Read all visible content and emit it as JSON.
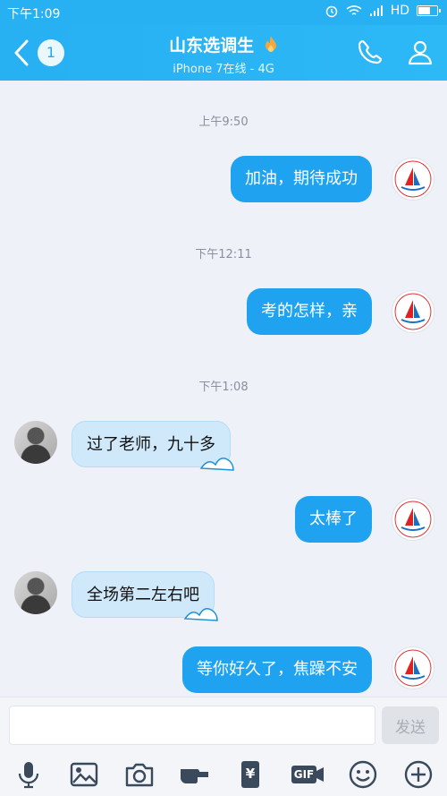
{
  "status_bar": {
    "time": "下午1:09",
    "network": "HD"
  },
  "header": {
    "unread_count": "1",
    "title": "山东选调生",
    "subtitle": "iPhone 7在线 - 4G"
  },
  "messages": [
    {
      "type": "timestamp",
      "text": "上午9:50"
    },
    {
      "type": "outgoing",
      "text": "加油，期待成功"
    },
    {
      "type": "timestamp",
      "text": "下午12:11"
    },
    {
      "type": "outgoing",
      "text": "考的怎样，亲"
    },
    {
      "type": "timestamp",
      "text": "下午1:08"
    },
    {
      "type": "incoming",
      "text": "过了老师，九十多"
    },
    {
      "type": "outgoing",
      "text": "太棒了"
    },
    {
      "type": "incoming",
      "text": "全场第二左右吧"
    },
    {
      "type": "outgoing",
      "text": "等你好久了，焦躁不安"
    }
  ],
  "input": {
    "value": "",
    "placeholder": ""
  },
  "send_label": "发送",
  "toolbar": {
    "items": [
      "microphone-icon",
      "image-icon",
      "camera-icon",
      "red-packet-hand-icon",
      "transfer-yuan-icon",
      "gif-icon",
      "emoji-icon",
      "plus-icon"
    ],
    "gif_label": "GIF",
    "yuan_label": "¥"
  },
  "colors": {
    "accent": "#27b0f2",
    "outgoing_bubble": "#1fa3f0",
    "incoming_bubble": "#cfe9fb"
  }
}
